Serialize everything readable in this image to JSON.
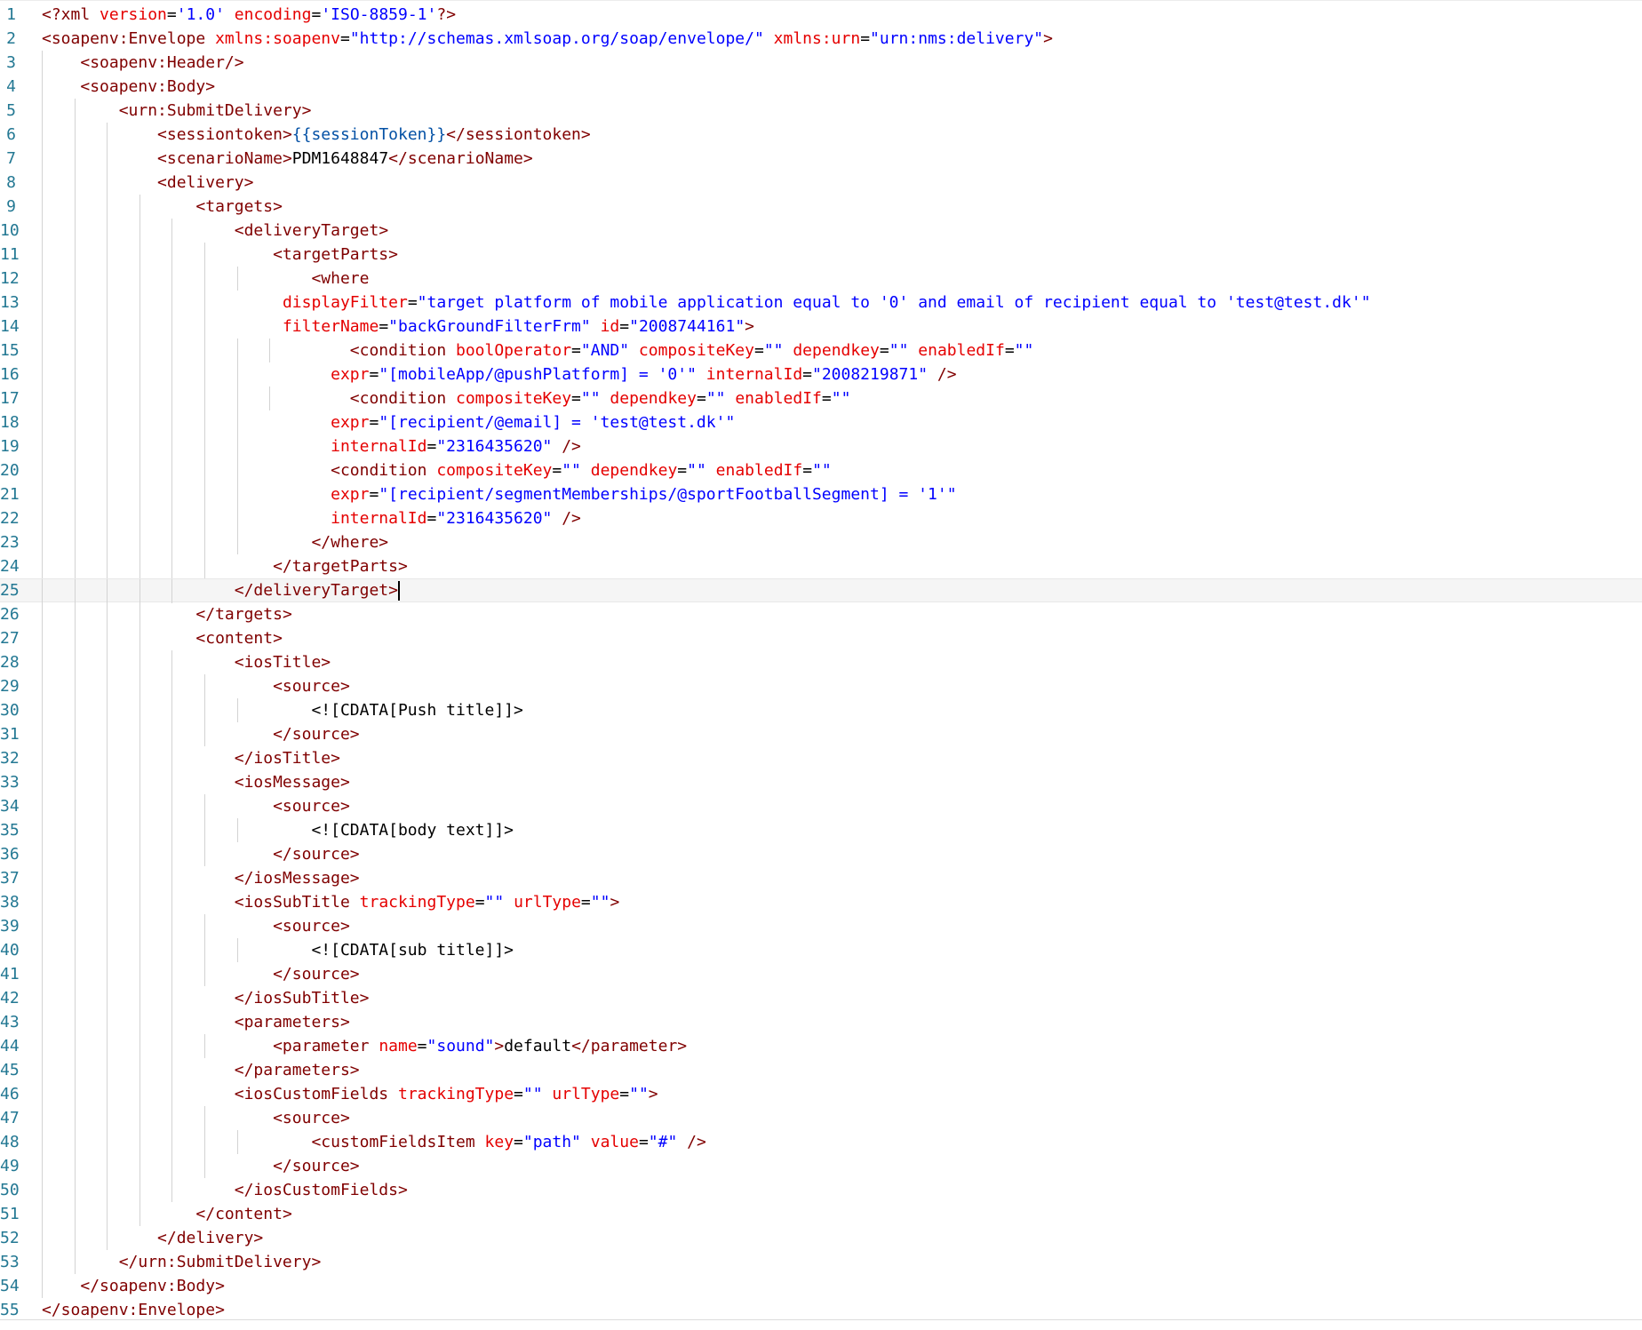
{
  "editor": {
    "language": "xml",
    "active_line": 25,
    "lines": [
      "<?xml version='1.0' encoding='ISO-8859-1'?>",
      "<soapenv:Envelope xmlns:soapenv=\"http://schemas.xmlsoap.org/soap/envelope/\" xmlns:urn=\"urn:nms:delivery\">",
      "    <soapenv:Header/>",
      "    <soapenv:Body>",
      "        <urn:SubmitDelivery>",
      "            <sessiontoken>{{sessionToken}}</sessiontoken>",
      "            <scenarioName>PDM1648847</scenarioName>",
      "            <delivery>",
      "                <targets>",
      "                    <deliveryTarget>",
      "                        <targetParts>",
      "                            <where",
      "                         displayFilter=\"target platform of mobile application equal to '0' and email of recipient equal to 'test@test.dk'\"",
      "                         filterName=\"backGroundFilterFrm\" id=\"2008744161\">",
      "                                <condition boolOperator=\"AND\" compositeKey=\"\" dependkey=\"\" enabledIf=\"\"",
      "                              expr=\"[mobileApp/@pushPlatform] = '0'\" internalId=\"2008219871\" />",
      "                                <condition compositeKey=\"\" dependkey=\"\" enabledIf=\"\"",
      "                              expr=\"[recipient/@email] = 'test@test.dk'\"",
      "                              internalId=\"2316435620\" />",
      "                              <condition compositeKey=\"\" dependkey=\"\" enabledIf=\"\"",
      "                              expr=\"[recipient/segmentMemberships/@sportFootballSegment] = '1'\"",
      "                              internalId=\"2316435620\" />",
      "                            </where>",
      "                        </targetParts>",
      "                    </deliveryTarget>",
      "                </targets>",
      "                <content>",
      "                    <iosTitle>",
      "                        <source>",
      "                            <![CDATA[Push title]]>",
      "                        </source>",
      "                    </iosTitle>",
      "                    <iosMessage>",
      "                        <source>",
      "                            <![CDATA[body text]]>",
      "                        </source>",
      "                    </iosMessage>",
      "                    <iosSubTitle trackingType=\"\" urlType=\"\">",
      "                        <source>",
      "                            <![CDATA[sub title]]>",
      "                        </source>",
      "                    </iosSubTitle>",
      "                    <parameters>",
      "                        <parameter name=\"sound\">default</parameter>",
      "                    </parameters>",
      "                    <iosCustomFields trackingType=\"\" urlType=\"\">",
      "                        <source>",
      "                            <customFieldsItem key=\"path\" value=\"#\" />",
      "                        </source>",
      "                    </iosCustomFields>",
      "                </content>",
      "            </delivery>",
      "        </urn:SubmitDelivery>",
      "    </soapenv:Body>",
      "</soapenv:Envelope>"
    ]
  }
}
